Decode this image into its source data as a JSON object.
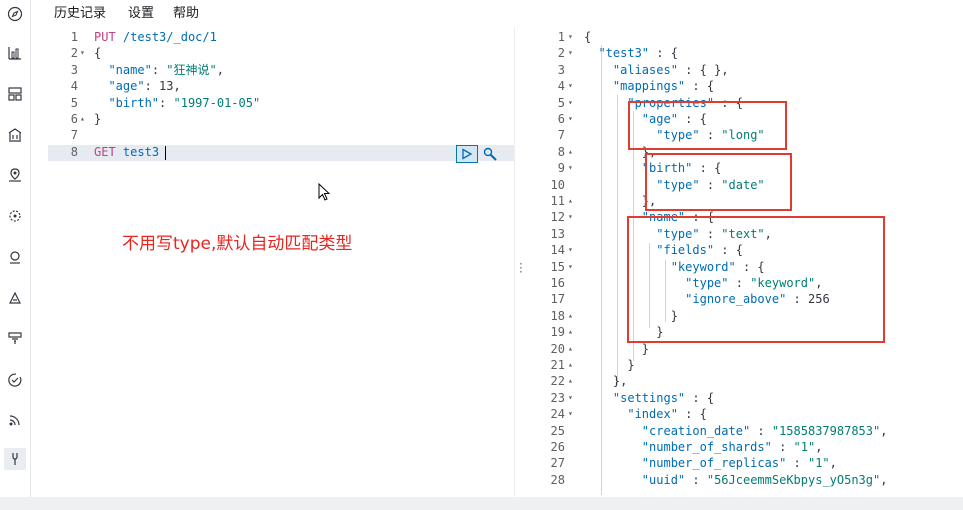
{
  "menu": {
    "history": "历史记录",
    "settings": "设置",
    "help": "帮助"
  },
  "rail_icons": [
    "compass-icon",
    "visualize-icon",
    "dashboard-icon",
    "canvas-icon",
    "maps-icon",
    "ml-icon",
    "infrastructure-icon",
    "logs-icon",
    "apm-icon",
    "uptime-icon",
    "siem-icon",
    "dev-tools-icon"
  ],
  "request_editor": {
    "lines": [
      {
        "num": "1",
        "fold": "",
        "text": "PUT /test3/_doc/1"
      },
      {
        "num": "2",
        "fold": "▾",
        "text": "{"
      },
      {
        "num": "3",
        "fold": "",
        "text": "  \"name\": \"狂神说\","
      },
      {
        "num": "4",
        "fold": "",
        "text": "  \"age\": 13,"
      },
      {
        "num": "5",
        "fold": "",
        "text": "  \"birth\": \"1997-01-05\""
      },
      {
        "num": "6",
        "fold": "▴",
        "text": "}"
      },
      {
        "num": "7",
        "fold": "",
        "text": ""
      },
      {
        "num": "8",
        "fold": "",
        "text": "GET test3"
      }
    ]
  },
  "annotation_text": "不用写type,默认自动匹配类型",
  "response_editor": {
    "lines": [
      {
        "num": "1",
        "fold": "▾",
        "text": "{"
      },
      {
        "num": "2",
        "fold": "▾",
        "text": "  \"test3\" : {"
      },
      {
        "num": "3",
        "fold": "",
        "text": "    \"aliases\" : { },"
      },
      {
        "num": "4",
        "fold": "▾",
        "text": "    \"mappings\" : {"
      },
      {
        "num": "5",
        "fold": "▾",
        "text": "      \"properties\" : {"
      },
      {
        "num": "6",
        "fold": "▾",
        "text": "        \"age\" : {"
      },
      {
        "num": "7",
        "fold": "",
        "text": "          \"type\" : \"long\""
      },
      {
        "num": "8",
        "fold": "▴",
        "text": "        },"
      },
      {
        "num": "9",
        "fold": "▾",
        "text": "        \"birth\" : {"
      },
      {
        "num": "10",
        "fold": "",
        "text": "          \"type\" : \"date\""
      },
      {
        "num": "11",
        "fold": "▴",
        "text": "        },"
      },
      {
        "num": "12",
        "fold": "▾",
        "text": "        \"name\" : {"
      },
      {
        "num": "13",
        "fold": "",
        "text": "          \"type\" : \"text\","
      },
      {
        "num": "14",
        "fold": "▾",
        "text": "          \"fields\" : {"
      },
      {
        "num": "15",
        "fold": "▾",
        "text": "            \"keyword\" : {"
      },
      {
        "num": "16",
        "fold": "",
        "text": "              \"type\" : \"keyword\","
      },
      {
        "num": "17",
        "fold": "",
        "text": "              \"ignore_above\" : 256"
      },
      {
        "num": "18",
        "fold": "▴",
        "text": "            }"
      },
      {
        "num": "19",
        "fold": "▴",
        "text": "          }"
      },
      {
        "num": "20",
        "fold": "▴",
        "text": "        }"
      },
      {
        "num": "21",
        "fold": "▴",
        "text": "      }"
      },
      {
        "num": "22",
        "fold": "▴",
        "text": "    },"
      },
      {
        "num": "23",
        "fold": "▾",
        "text": "    \"settings\" : {"
      },
      {
        "num": "24",
        "fold": "▾",
        "text": "      \"index\" : {"
      },
      {
        "num": "25",
        "fold": "",
        "text": "        \"creation_date\" : \"1585837987853\","
      },
      {
        "num": "26",
        "fold": "",
        "text": "        \"number_of_shards\" : \"1\","
      },
      {
        "num": "27",
        "fold": "",
        "text": "        \"number_of_replicas\" : \"1\","
      },
      {
        "num": "28",
        "fold": "",
        "text": "        \"uuid\" : \"56JceemmSeKbpys_yO5n3g\","
      }
    ]
  },
  "colors": {
    "annotation": "#e8251f",
    "highlight_box": "#e03c31",
    "keyword": "#c4407c",
    "json_key": "#006bb4",
    "json_string": "#017d73"
  }
}
